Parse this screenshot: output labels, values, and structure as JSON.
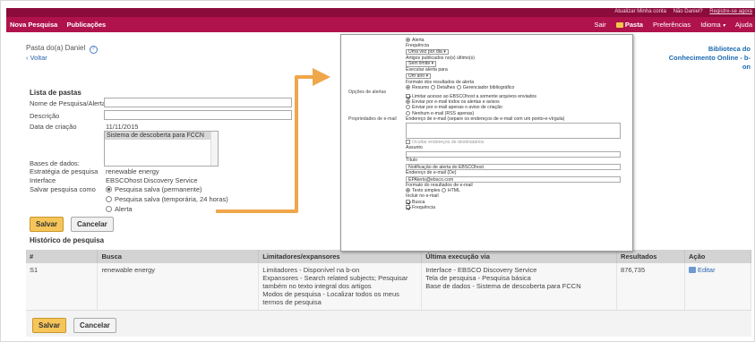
{
  "colors": {
    "top_bar": "#8b0b3a",
    "nav_bar": "#b0134c",
    "accent_link": "#1a6ab0",
    "arrow": "#f0a64a",
    "save_button": "#f5c55a"
  },
  "top_links": [
    "Atualizar Minha conta",
    "Não Daniel?",
    "Registre-se agora"
  ],
  "nav": {
    "left": [
      "Nova Pesquisa",
      "Publicações"
    ],
    "right_sair": "Sair",
    "right_pasta": "Pasta",
    "right_prefs": "Preferências",
    "right_idioma": "Idioma",
    "right_ajuda": "Ajuda"
  },
  "header": {
    "title": "Pasta do(a) Daniel",
    "help": "?",
    "back": "‹ Voltar",
    "right_link": "Biblioteca do Conhecimento Online - b-on"
  },
  "form": {
    "section_title": "Lista de pastas",
    "name_label": "Nome de Pesquisa/Alerta",
    "name_value": "",
    "desc_label": "Descrição",
    "desc_value": "",
    "created_label": "Data de criação",
    "created_value": "11/11/2015",
    "database_option": "Sistema de descoberta para FCCN",
    "databases_label": "Bases de dados:",
    "databases_value": "",
    "strategy_label": "Estratégia de pesquisa",
    "strategy_value": "renewable energy",
    "interface_label": "Interface",
    "interface_value": "EBSCOhost Discovery Service",
    "save_as_label": "Salvar pesquisa como",
    "save_options": [
      "Pesquisa salva (permanente)",
      "Pesquisa salva (temporária, 24 horas)",
      "Alerta"
    ],
    "save_button": "Salvar",
    "cancel_button": "Cancelar"
  },
  "history": {
    "title": "Histórico de pesquisa",
    "columns": [
      "#",
      "Busca",
      "Limitadores/expansores",
      "Última execução via",
      "Resultados",
      "Ação"
    ],
    "rows": [
      {
        "num": "S1",
        "busca": "renewable energy",
        "limitadores": [
          "Limitadores - Disponível na b-on",
          "Expansores - Search related subjects; Pesquisar também no texto integral dos artigos",
          "Modos de pesquisa - Localizar todos os meus termos de pesquisa"
        ],
        "execucao": [
          "Interface - EBSCO Discovery Service",
          "Tela de pesquisa - Pesquisa básica",
          "Base de dados - Sistema de descoberta para FCCN"
        ],
        "resultados": "876,735",
        "acao": "Editar"
      }
    ],
    "save_button": "Salvar",
    "cancel_button": "Cancelar"
  },
  "alert_panel": {
    "alerta_radio": "Alerta",
    "frequencia_label": "Frequência",
    "frequencia_value": "Uma vez por dia",
    "artigos_label": "Artigos publicados no(s) último(s)",
    "artigos_value": "Sem limite",
    "executar_label": "Executar alerta para",
    "executar_value": "Um ano",
    "opcoes_label": "Opções de alertas",
    "formato_label": "Formato dos resultados de alerta",
    "formato_options": [
      "Resumo",
      "Detalhes",
      "Gerenciador bibliográfico"
    ],
    "propriedades_label": "Propriedades de e-mail",
    "limitar_label": "Limitar acesso ao EBSCOhost a somente arquivos enviados",
    "email_options": [
      "Enviar por e-mail todos os alertas e avisos",
      "Enviar por e-mail apenas o aviso de criação",
      "Nenhum e-mail (RSS apenas)"
    ],
    "enderecos_label": "Endereço de e-mail (separe os endereços de e-mail com um ponto-e-vírgula)",
    "ocultar_label": "Ocultar endereços de destinatários",
    "assunto_label": "Assunto",
    "assunto_value": "",
    "titulo_label": "Título",
    "titulo_value": "Notificação de alerta do EBSCOhost",
    "de_label": "Endereço de e-mail (De)",
    "de_value": "EPAlerts@ebsco.com",
    "formato_email_label": "Formato do resultados de e-mail",
    "formato_email_options": [
      "Texto simples",
      "HTML"
    ],
    "incluir_label": "Incluir no e-mail",
    "incluir_options": [
      "Busca",
      "Frequência"
    ]
  }
}
